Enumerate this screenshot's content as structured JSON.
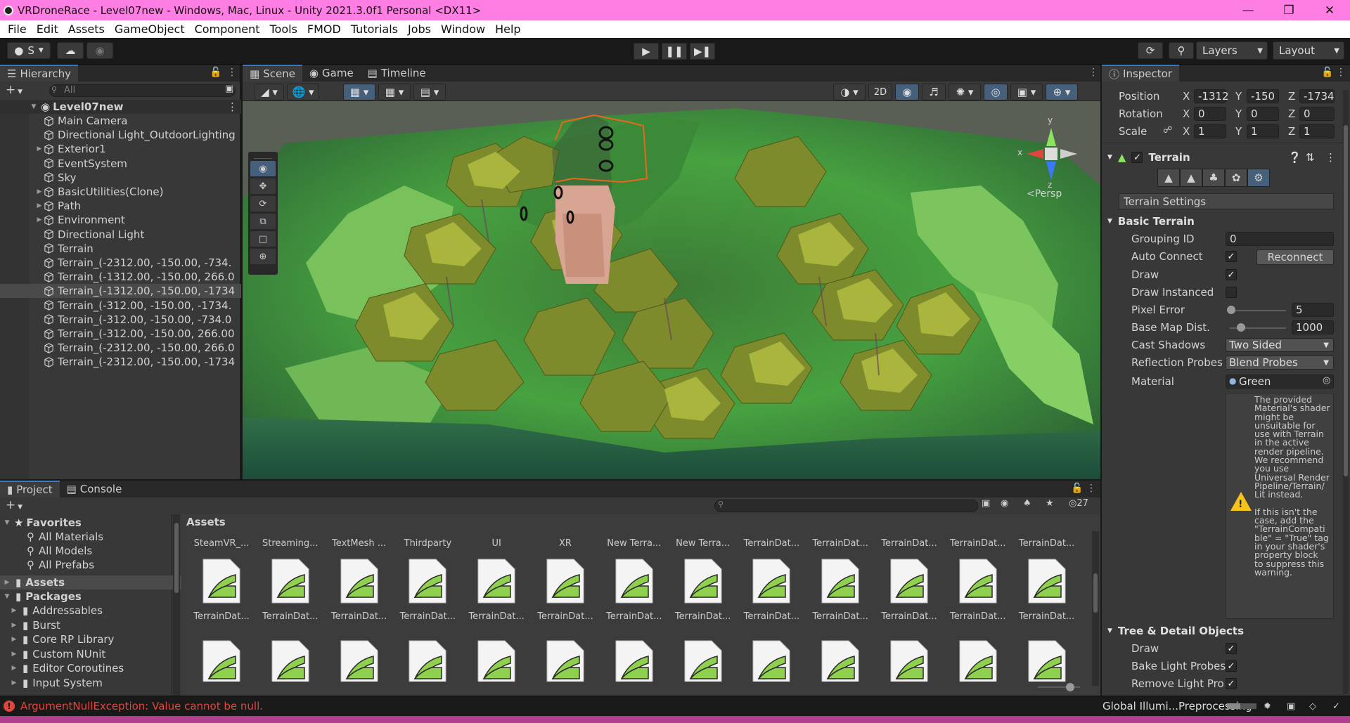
{
  "window": {
    "title": "VRDroneRace - Level07new - Windows, Mac, Linux - Unity 2021.3.0f1 Personal <DX11>"
  },
  "menu": [
    "File",
    "Edit",
    "Assets",
    "GameObject",
    "Component",
    "Tools",
    "FMOD",
    "Tutorials",
    "Jobs",
    "Window",
    "Help"
  ],
  "toolbar": {
    "account": "S",
    "layers": "Layers",
    "layout": "Layout"
  },
  "hierarchy": {
    "tab": "Hierarchy",
    "search_placeholder": "All",
    "scene": "Level07new",
    "items": [
      {
        "name": "Main Camera",
        "fold": false,
        "selected": false
      },
      {
        "name": "Directional Light_OutdoorLighting",
        "fold": false,
        "selected": false
      },
      {
        "name": "Exterior1",
        "fold": true,
        "selected": false
      },
      {
        "name": "EventSystem",
        "fold": false,
        "selected": false
      },
      {
        "name": "Sky",
        "fold": false,
        "selected": false
      },
      {
        "name": "BasicUtilities(Clone)",
        "fold": true,
        "selected": false
      },
      {
        "name": "Path",
        "fold": true,
        "selected": false
      },
      {
        "name": "Environment",
        "fold": true,
        "selected": false
      },
      {
        "name": "Directional Light",
        "fold": false,
        "selected": false
      },
      {
        "name": "Terrain",
        "fold": false,
        "selected": false
      },
      {
        "name": "Terrain_(-2312.00, -150.00, -734.",
        "fold": false,
        "selected": false
      },
      {
        "name": "Terrain_(-1312.00, -150.00, 266.0",
        "fold": false,
        "selected": false
      },
      {
        "name": "Terrain_(-1312.00, -150.00, -1734",
        "fold": false,
        "selected": true
      },
      {
        "name": "Terrain_(-312.00, -150.00, -1734.",
        "fold": false,
        "selected": false
      },
      {
        "name": "Terrain_(-312.00, -150.00, -734.0",
        "fold": false,
        "selected": false
      },
      {
        "name": "Terrain_(-312.00, -150.00, 266.00",
        "fold": false,
        "selected": false
      },
      {
        "name": "Terrain_(-2312.00, -150.00, 266.0",
        "fold": false,
        "selected": false
      },
      {
        "name": "Terrain_(-2312.00, -150.00, -1734",
        "fold": false,
        "selected": false
      }
    ]
  },
  "scene": {
    "tabs": [
      "Scene",
      "Game",
      "Timeline"
    ],
    "btn_2d": "2D",
    "persp": "Persp",
    "axis": {
      "x": "x",
      "y": "y",
      "z": "z"
    }
  },
  "inspector": {
    "tab": "Inspector",
    "transform": {
      "position_label": "Position",
      "rotation_label": "Rotation",
      "scale_label": "Scale",
      "position": {
        "x": "-1312",
        "y": "-150",
        "z": "-1734"
      },
      "rotation": {
        "x": "0",
        "y": "0",
        "z": "0"
      },
      "scale": {
        "x": "1",
        "y": "1",
        "z": "1"
      }
    },
    "component": "Terrain",
    "settings_button": "Terrain Settings",
    "basic_terrain": "Basic Terrain",
    "grouping_id_label": "Grouping ID",
    "grouping_id": "0",
    "auto_connect_label": "Auto Connect",
    "reconnect": "Reconnect",
    "draw_label": "Draw",
    "draw_instanced_label": "Draw Instanced",
    "pixel_error_label": "Pixel Error",
    "pixel_error": "5",
    "pixel_error_slider": 0.03,
    "base_map_label": "Base Map Dist.",
    "base_map": "1000",
    "base_map_slider": 0.2,
    "cast_shadows_label": "Cast Shadows",
    "cast_shadows": "Two Sided",
    "reflection_label": "Reflection Probes",
    "reflection": "Blend Probes",
    "material_label": "Material",
    "material": "Green",
    "warning": [
      "The provided",
      "Material's shader",
      "might be",
      "unsuitable for",
      "use with Terrain",
      "in the active",
      "render pipeline.",
      "We recommend",
      "you use",
      "Universal Render",
      "Pipeline/Terrain/",
      "Lit instead.",
      "",
      "If this isn't the",
      "case, add the",
      "\"TerrainCompati",
      "ble\" = \"True\" tag",
      "in your shader's",
      "property block",
      "to suppress this",
      "warning."
    ],
    "tree_detail": "Tree & Detail Objects",
    "td_draw_label": "Draw",
    "bake_label": "Bake Light Probes",
    "remove_label": "Remove Light Pro"
  },
  "project": {
    "tabs": [
      "Project",
      "Console"
    ],
    "hidden_count": "27",
    "assets_header": "Assets",
    "favorites": "Favorites",
    "fav_items": [
      "All Materials",
      "All Models",
      "All Prefabs"
    ],
    "assets_root": "Assets",
    "packages_root": "Packages",
    "packages": [
      "Addressables",
      "Burst",
      "Core RP Library",
      "Custom NUnit",
      "Editor Coroutines",
      "Input System"
    ],
    "row1": [
      "SteamVR_...",
      "Streaming...",
      "TextMesh ...",
      "Thirdparty",
      "UI",
      "XR",
      "New Terra...",
      "New Terra...",
      "TerrainDat...",
      "TerrainDat...",
      "TerrainDat...",
      "TerrainDat...",
      "TerrainDat..."
    ],
    "row2": [
      "TerrainDat...",
      "TerrainDat...",
      "TerrainDat...",
      "TerrainDat...",
      "TerrainDat...",
      "TerrainDat...",
      "TerrainDat...",
      "TerrainDat...",
      "TerrainDat...",
      "TerrainDat...",
      "TerrainDat...",
      "TerrainDat...",
      "TerrainDat..."
    ]
  },
  "status": {
    "error": "ArgumentNullException: Value cannot be null.",
    "progress": "Global Illumi...Preprocessing"
  },
  "colors": {
    "title_bar": "#ff7ee3",
    "accent": "#3a79bb",
    "error": "#e0463c",
    "terrain_green": "#8fd14f"
  }
}
